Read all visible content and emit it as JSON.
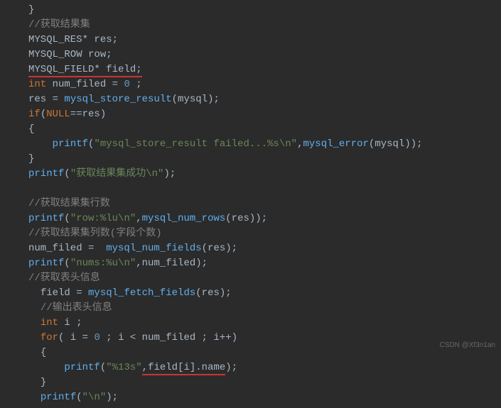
{
  "code": {
    "l0": "}",
    "l1_comment": "//获取结果集",
    "l2": "MYSQL_RES* res;",
    "l3": "MYSQL_ROW row;",
    "l4": "MYSQL_FIELD* field;",
    "l5_a": "int",
    "l5_b": " num_filed = ",
    "l5_c": "0",
    "l5_d": " ;",
    "l6_a": "res = ",
    "l6_b": "mysql_store_result",
    "l6_c": "(mysql);",
    "l7_a": "if",
    "l7_b": "(",
    "l7_c": "NULL",
    "l7_d": "==res)",
    "l8": "{",
    "l9_a": "printf",
    "l9_b": "(",
    "l9_c": "\"mysql_store_result failed...%s\\n\"",
    "l9_d": ",",
    "l9_e": "mysql_error",
    "l9_f": "(mysql));",
    "l10": "}",
    "l11_a": "printf",
    "l11_b": "(",
    "l11_c": "\"获取结果集成功\\n\"",
    "l11_d": ");",
    "l13_comment": "//获取结果集行数",
    "l14_a": "printf",
    "l14_b": "(",
    "l14_c": "\"row:%lu\\n\"",
    "l14_d": ",",
    "l14_e": "mysql_num_rows",
    "l14_f": "(res));",
    "l15_comment": "//获取结果集列数(字段个数)",
    "l16_a": "num_filed =  ",
    "l16_b": "mysql_num_fields",
    "l16_c": "(res);",
    "l17_a": "printf",
    "l17_b": "(",
    "l17_c": "\"nums:%u\\n\"",
    "l17_d": ",num_filed);",
    "l18_comment": "//获取表头信息",
    "l19_a": "field = ",
    "l19_b": "mysql_fetch_fields",
    "l19_c": "(res);",
    "l20_comment": "//输出表头信息",
    "l21_a": "int",
    "l21_b": " i ;",
    "l22_a": "for",
    "l22_b": "( i = ",
    "l22_c": "0",
    "l22_d": " ; i < num_filed ; i++)",
    "l23": "{",
    "l24_a": "printf",
    "l24_b": "(",
    "l24_c": "\"%13s\"",
    "l24_d": ",field[i].name",
    "l24_e": ");",
    "l25": "}",
    "l26_a": "printf",
    "l26_b": "(",
    "l26_c": "\"\\n\"",
    "l26_d": ");"
  },
  "watermark": "CSDN @Xf3n1an"
}
